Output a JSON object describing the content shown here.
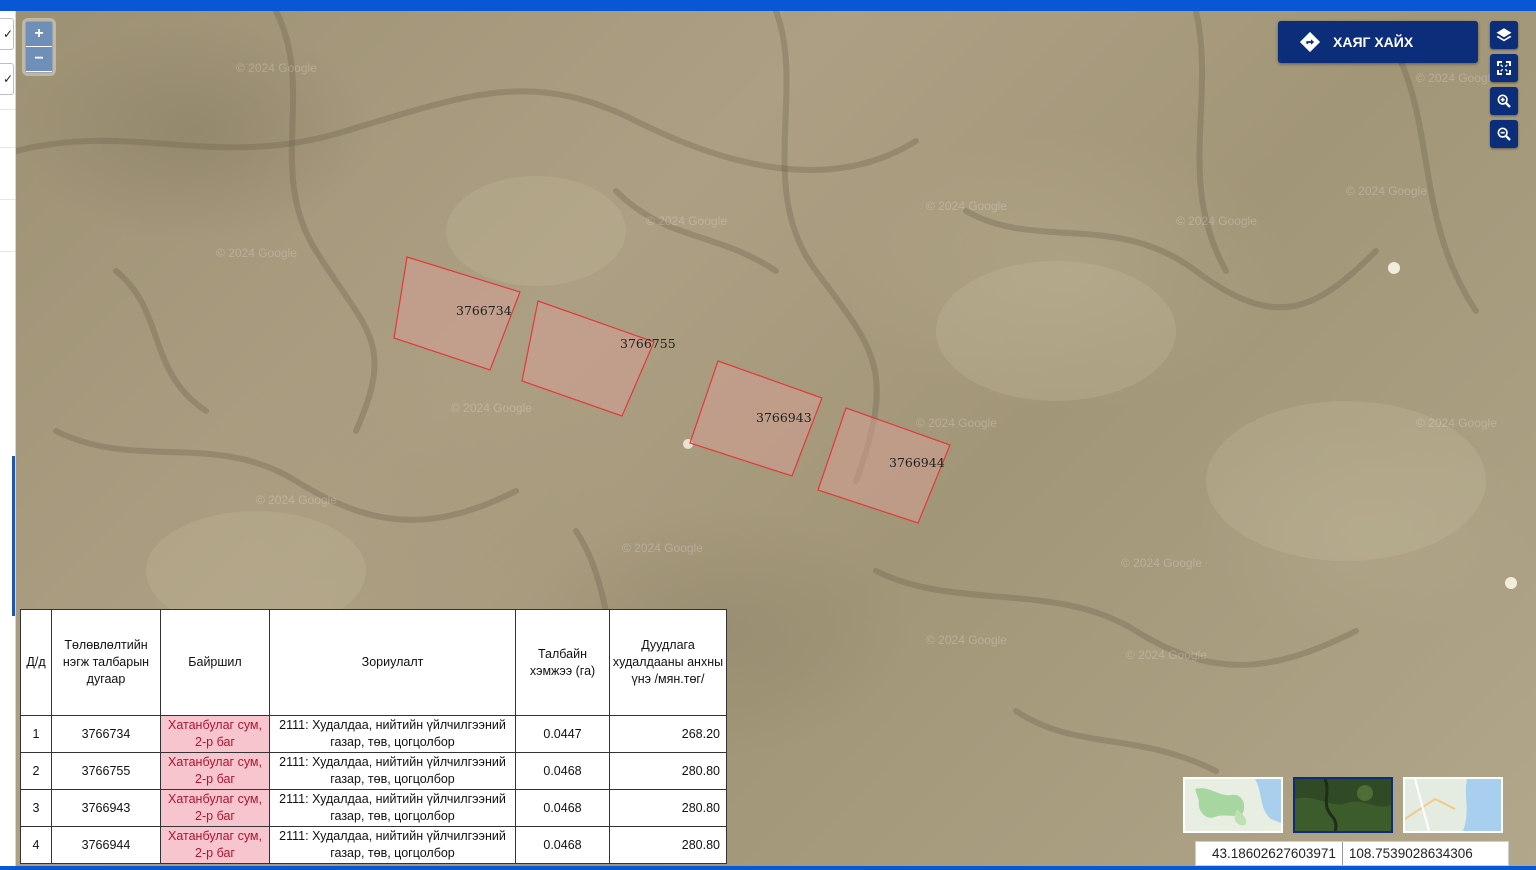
{
  "map": {
    "watermark": "© 2024 Google",
    "zoom_in_label": "+",
    "zoom_out_label": "−",
    "parcels": [
      "3766734",
      "3766755",
      "3766943",
      "3766944"
    ]
  },
  "toolbar": {
    "address_search_label": "ХАЯГ ХАЙХ",
    "icons": [
      "layers-icon",
      "fullscreen-icon",
      "zoom-in-icon",
      "zoom-out-icon"
    ]
  },
  "table": {
    "headers": {
      "no": "Д/д",
      "parcel_number": "Төлөвлөлтийн нэгж талбарын дугаар",
      "location": "Байршил",
      "purpose": "Зориулалт",
      "area": "Талбайн хэмжээ (га)",
      "price": "Дуудлага худалдааны анхны үнэ /мян.төг/"
    },
    "rows": [
      {
        "no": "1",
        "parcel": "3766734",
        "location": "Хатанбулаг сум, 2-р баг",
        "purpose": "2111: Худалдаа, нийтийн үйлчилгээний газар, төв, цогцолбор",
        "area": "0.0447",
        "price": "268.20"
      },
      {
        "no": "2",
        "parcel": "3766755",
        "location": "Хатанбулаг сум, 2-р баг",
        "purpose": "2111: Худалдаа, нийтийн үйлчилгээний газар, төв, цогцолбор",
        "area": "0.0468",
        "price": "280.80"
      },
      {
        "no": "3",
        "parcel": "3766943",
        "location": "Хатанбулаг сум, 2-р баг",
        "purpose": "2111: Худалдаа, нийтийн үйлчилгээний газар, төв, цогцолбор",
        "area": "0.0468",
        "price": "280.80"
      },
      {
        "no": "4",
        "parcel": "3766944",
        "location": "Хатанбулаг сум, 2-р баг",
        "purpose": "2111: Худалдаа, нийтийн үйлчилгээний газар, төв, цогцолбор",
        "area": "0.0468",
        "price": "280.80"
      }
    ]
  },
  "coordinates": {
    "lat": "43.18602627603971",
    "lon": "108.7539028634306"
  },
  "colors": {
    "accent": "#0b2d7a",
    "parcel_stroke": "#e03a3a",
    "location_bg": "#f6c5cd",
    "location_text": "#b0152e"
  }
}
